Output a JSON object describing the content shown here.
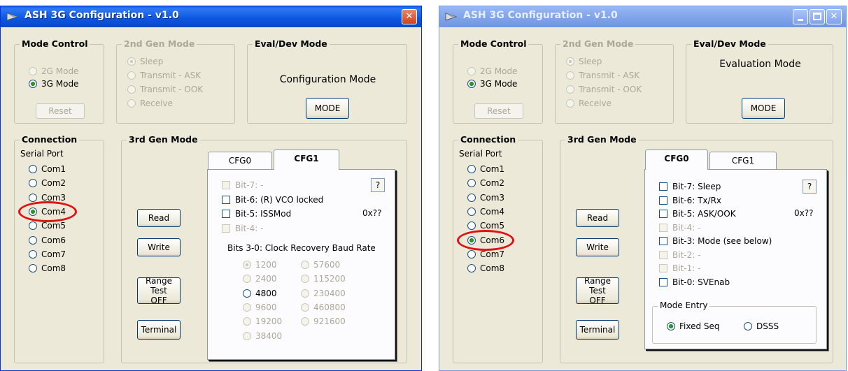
{
  "windows": [
    {
      "title": "ASH 3G Configuration - v1.0",
      "active": true,
      "title_buttons": [
        "close"
      ],
      "mode_control": {
        "legend": "Mode Control",
        "options": [
          {
            "label": "2G Mode",
            "checked": false,
            "enabled": false
          },
          {
            "label": "3G Mode",
            "checked": true,
            "enabled": true
          }
        ],
        "reset_label": "Reset"
      },
      "gen2": {
        "legend": "2nd Gen Mode",
        "options": [
          {
            "label": "Sleep",
            "checked": true
          },
          {
            "label": "Transmit - ASK",
            "checked": false
          },
          {
            "label": "Transmit - OOK",
            "checked": false
          },
          {
            "label": "Receive",
            "checked": false
          }
        ]
      },
      "eval": {
        "legend": "Eval/Dev Mode",
        "status": "Configuration Mode",
        "mode_label": "MODE"
      },
      "connection": {
        "legend": "Connection",
        "port_label": "Serial Port",
        "ports": [
          "Com1",
          "Com2",
          "Com3",
          "Com4",
          "Com5",
          "Com6",
          "Com7",
          "Com8"
        ],
        "selected": "Com4"
      },
      "gen3": {
        "legend": "3rd Gen Mode",
        "read_label": "Read",
        "write_label": "Write",
        "range_label": "Range Test\nOFF",
        "terminal_label": "Terminal",
        "tabs": [
          "CFG0",
          "CFG1"
        ],
        "active_tab": "CFG1",
        "bits": [
          {
            "label": "Bit-7: -",
            "enabled": false
          },
          {
            "label": "Bit-6: (R) VCO locked",
            "enabled": true
          },
          {
            "label": "Bit-5: ISSMod",
            "enabled": true
          },
          {
            "label": "Bit-4: -",
            "enabled": false
          }
        ],
        "help_label": "?",
        "hex_value": "0x??",
        "baud": {
          "heading": "Bits 3-0: Clock Recovery Baud Rate",
          "col1": [
            {
              "label": "1200",
              "checked": true,
              "enabled": false
            },
            {
              "label": "2400",
              "checked": false,
              "enabled": false
            },
            {
              "label": "4800",
              "checked": false,
              "enabled": true
            },
            {
              "label": "9600",
              "checked": false,
              "enabled": false
            },
            {
              "label": "19200",
              "checked": false,
              "enabled": false
            },
            {
              "label": "38400",
              "checked": false,
              "enabled": false
            }
          ],
          "col2": [
            {
              "label": "57600",
              "checked": false,
              "enabled": false
            },
            {
              "label": "115200",
              "checked": false,
              "enabled": false
            },
            {
              "label": "230400",
              "checked": false,
              "enabled": false
            },
            {
              "label": "460800",
              "checked": false,
              "enabled": false
            },
            {
              "label": "921600",
              "checked": false,
              "enabled": false
            }
          ]
        }
      }
    },
    {
      "title": "ASH 3G Configuration - v1.0",
      "active": false,
      "title_buttons": [
        "minimize",
        "maximize",
        "close"
      ],
      "mode_control": {
        "legend": "Mode Control",
        "options": [
          {
            "label": "2G Mode",
            "checked": false,
            "enabled": false
          },
          {
            "label": "3G Mode",
            "checked": true,
            "enabled": true
          }
        ],
        "reset_label": "Reset"
      },
      "gen2": {
        "legend": "2nd Gen Mode",
        "options": [
          {
            "label": "Sleep",
            "checked": true
          },
          {
            "label": "Transmit - ASK",
            "checked": false
          },
          {
            "label": "Transmit - OOK",
            "checked": false
          },
          {
            "label": "Receive",
            "checked": false
          }
        ]
      },
      "eval": {
        "legend": "Eval/Dev Mode",
        "status": "Evaluation Mode",
        "mode_label": "MODE"
      },
      "connection": {
        "legend": "Connection",
        "port_label": "Serial Port",
        "ports": [
          "Com1",
          "Com2",
          "Com3",
          "Com4",
          "Com5",
          "Com6",
          "Com7",
          "Com8"
        ],
        "selected": "Com6"
      },
      "gen3": {
        "legend": "3rd Gen Mode",
        "read_label": "Read",
        "write_label": "Write",
        "range_label": "Range Test\nOFF",
        "terminal_label": "Terminal",
        "tabs": [
          "CFG0",
          "CFG1"
        ],
        "active_tab": "CFG0",
        "bits": [
          {
            "label": "Bit-7: Sleep",
            "enabled": true
          },
          {
            "label": "Bit-6: Tx/Rx",
            "enabled": true
          },
          {
            "label": "Bit-5: ASK/OOK",
            "enabled": true
          },
          {
            "label": "Bit-4: -",
            "enabled": false
          },
          {
            "label": "Bit-3: Mode (see below)",
            "enabled": true
          },
          {
            "label": "Bit-2: -",
            "enabled": false
          },
          {
            "label": "Bit-1: -",
            "enabled": false
          },
          {
            "label": "Bit-0: SVEnab",
            "enabled": true
          }
        ],
        "help_label": "?",
        "hex_value": "0x??",
        "mode_entry": {
          "legend": "Mode Entry",
          "options": [
            {
              "label": "Fixed Seq",
              "checked": true
            },
            {
              "label": "DSSS",
              "checked": false
            }
          ]
        }
      }
    }
  ],
  "colors": {
    "highlight": "#e01212",
    "title_active": "#0a55df",
    "title_inactive": "#7b9ee8",
    "face": "#ece9d8"
  }
}
